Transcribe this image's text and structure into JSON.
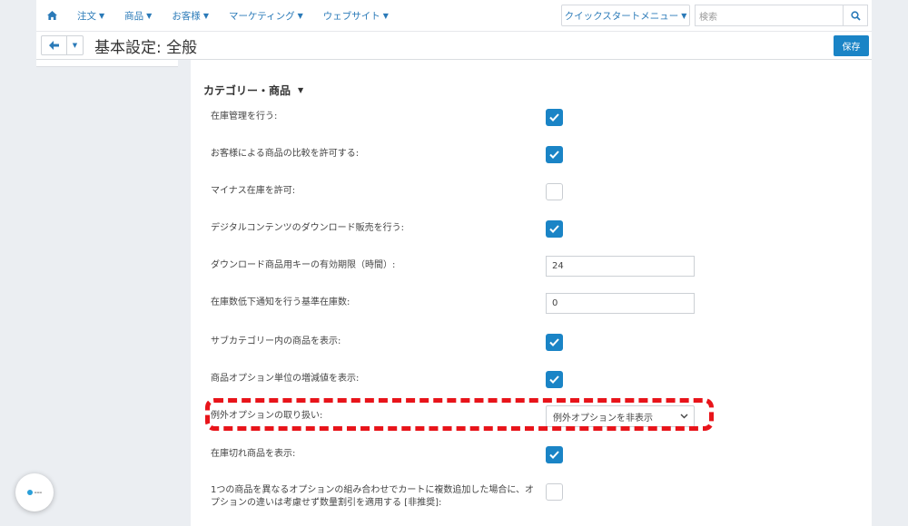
{
  "nav": {
    "items": [
      {
        "label": "注文"
      },
      {
        "label": "商品"
      },
      {
        "label": "お客様"
      },
      {
        "label": "マーケティング"
      },
      {
        "label": "ウェブサイト"
      }
    ],
    "quick_start": "クイックスタートメニュー",
    "search_placeholder": "検索"
  },
  "header": {
    "title": "基本設定: 全般",
    "save_label": "保存"
  },
  "section": {
    "title": "カテゴリー・商品"
  },
  "settings": [
    {
      "label": "在庫管理を行う:",
      "type": "checkbox",
      "checked": true
    },
    {
      "label": "お客様による商品の比較を許可する:",
      "type": "checkbox",
      "checked": true
    },
    {
      "label": "マイナス在庫を許可:",
      "type": "checkbox",
      "checked": false
    },
    {
      "label": "デジタルコンテンツのダウンロード販売を行う:",
      "type": "checkbox",
      "checked": true
    },
    {
      "label": "ダウンロード商品用キーの有効期限（時間）:",
      "type": "input",
      "value": "24"
    },
    {
      "label": "在庫数低下通知を行う基準在庫数:",
      "type": "input",
      "value": "0"
    },
    {
      "label": "サブカテゴリー内の商品を表示:",
      "type": "checkbox",
      "checked": true
    },
    {
      "label": "商品オプション単位の増減値を表示:",
      "type": "checkbox",
      "checked": true
    },
    {
      "label": "例外オプションの取り扱い:",
      "type": "select",
      "value": "例外オプションを非表示"
    },
    {
      "label": "在庫切れ商品を表示:",
      "type": "checkbox",
      "checked": true
    },
    {
      "label_line1": "1つの商品を異なるオプションの組み合わせでカートに複数追加した場合に、オ",
      "label_line2": "プションの違いは考慮せず数量割引を適用する [非推奨]:",
      "type": "checkbox",
      "checked": false
    }
  ],
  "colors": {
    "accent": "#1a84c6",
    "highlight": "#e8141a",
    "link": "#2a7ab8"
  }
}
